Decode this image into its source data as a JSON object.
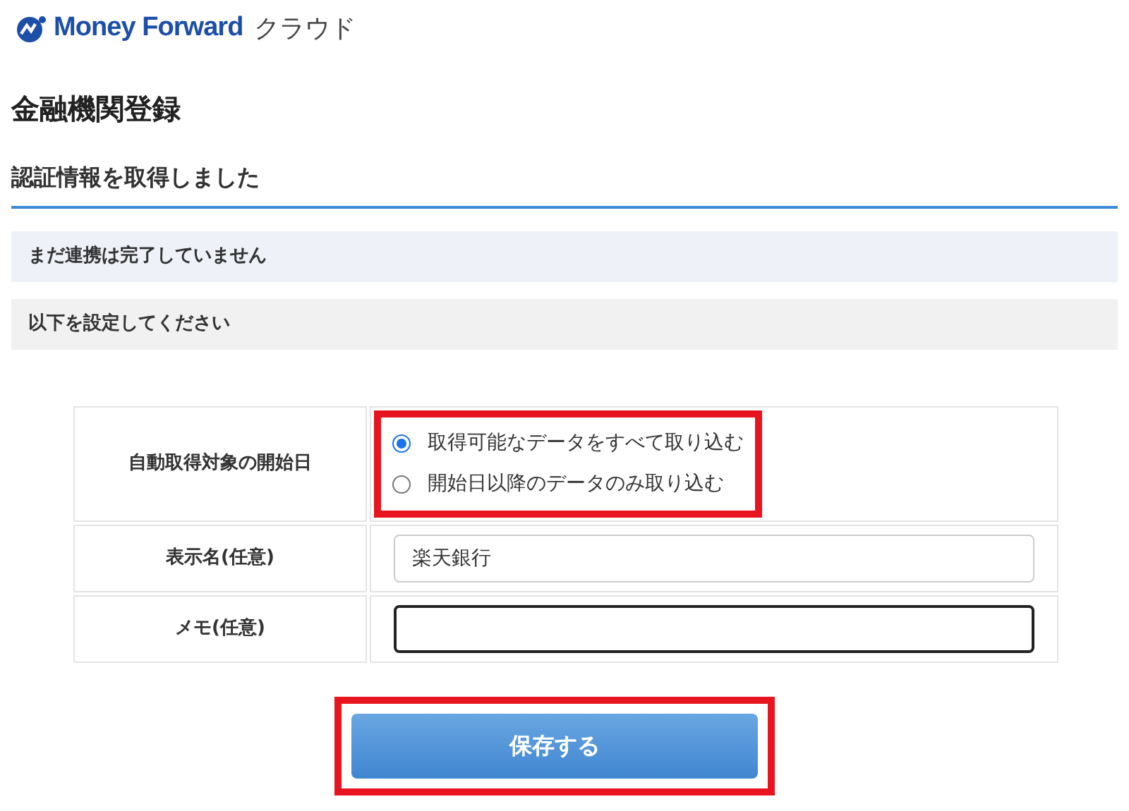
{
  "logo": {
    "brand": "Money Forward",
    "product": "クラウド"
  },
  "page_title": "金融機関登録",
  "section_title": "認証情報を取得しました",
  "notices": [
    "まだ連携は完了していません",
    "以下を設定してください"
  ],
  "form": {
    "rows": [
      {
        "kind": "radio",
        "label": "自動取得対象の開始日",
        "highlighted": true,
        "options": [
          {
            "label": "取得可能なデータをすべて取り込む",
            "selected": true
          },
          {
            "label": "開始日以降のデータのみ取り込む",
            "selected": false
          }
        ]
      },
      {
        "kind": "text",
        "label": "表示名(任意)",
        "value": "楽天銀行",
        "focused": false
      },
      {
        "kind": "text",
        "label": "メモ(任意)",
        "value": "",
        "focused": true
      }
    ]
  },
  "save_button": {
    "label": "保存する",
    "highlighted": true
  }
}
